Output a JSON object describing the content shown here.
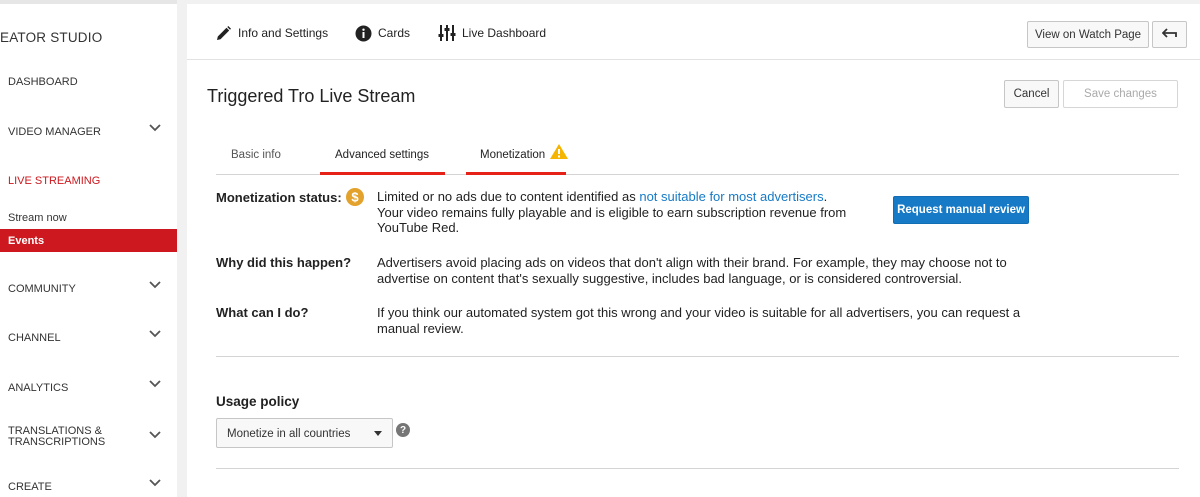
{
  "sidebar": {
    "brand": "EATOR STUDIO",
    "items": [
      {
        "label": "DASHBOARD"
      },
      {
        "label": "VIDEO MANAGER"
      },
      {
        "label": "LIVE STREAMING"
      },
      {
        "label": "COMMUNITY"
      },
      {
        "label": "CHANNEL"
      },
      {
        "label": "ANALYTICS"
      },
      {
        "label": "TRANSLATIONS &"
      },
      {
        "label": "TRANSCRIPTIONS"
      },
      {
        "label": "CREATE"
      }
    ],
    "sub_items": [
      {
        "label": "Stream now"
      },
      {
        "label": "Events"
      }
    ]
  },
  "topbar": {
    "tabs": [
      {
        "label": "Info and Settings",
        "icon": "pencil-icon"
      },
      {
        "label": "Cards",
        "icon": "info-icon"
      },
      {
        "label": "Live Dashboard",
        "icon": "sliders-icon"
      }
    ],
    "view_button": "View on Watch Page",
    "back_icon": "back-arrow-icon"
  },
  "page": {
    "title": "Triggered Tro Live Stream",
    "cancel": "Cancel",
    "save": "Save changes"
  },
  "tabs": {
    "basic": "Basic info",
    "advanced": "Advanced settings",
    "monetization": "Monetization"
  },
  "monetization": {
    "status_label": "Monetization status:",
    "status_text_1": "Limited or no ads due to content identified as ",
    "status_link": "not suitable for most advertisers",
    "status_text_2": ".",
    "status_text_3": "Your video remains fully playable and is eligible to earn subscription revenue from",
    "status_text_4": "YouTube Red.",
    "review_button": "Request manual review",
    "why_label": "Why did this happen?",
    "why_text_1": "Advertisers avoid placing ads on videos that don't align with their brand. For example, they may choose not to",
    "why_text_2": "advertise on content that's sexually suggestive, includes bad language, or is considered controversial.",
    "what_label": "What can I do?",
    "what_text_1": "If you think our automated system got this wrong and your video is suitable for all advertisers, you can request a",
    "what_text_2": "manual review."
  },
  "usage": {
    "label": "Usage policy",
    "selected": "Monetize in all countries",
    "help": "?"
  },
  "colors": {
    "accent_red": "#cc181e",
    "tab_underline": "#e62117",
    "link_blue": "#167ac6",
    "warning_yellow": "#f4b400",
    "coin_gold": "#e3a22b"
  }
}
